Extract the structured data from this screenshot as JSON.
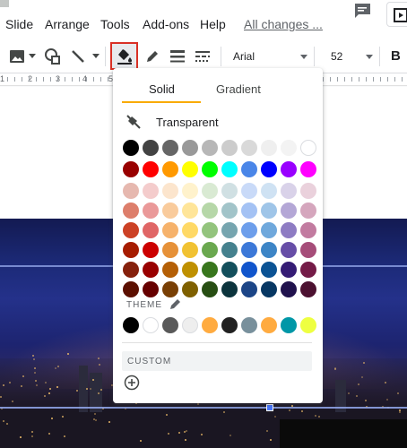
{
  "menu": {
    "items": [
      "Slide",
      "Arrange",
      "Tools",
      "Add-ons",
      "Help"
    ],
    "changes_link": "All changes ..."
  },
  "toolbar": {
    "icons": [
      "image-icon",
      "shapes-icon",
      "line-icon",
      "fill-color-icon",
      "pen-icon",
      "border-weight-icon",
      "border-dash-icon"
    ],
    "font": "Arial",
    "size": "52",
    "bold_label": "B",
    "active_tool": "fill-color"
  },
  "ruler": {
    "labels": [
      "1",
      "2",
      "3",
      "4",
      "5"
    ]
  },
  "color_panel": {
    "tabs": [
      {
        "label": "Solid",
        "selected": true
      },
      {
        "label": "Gradient",
        "selected": false
      }
    ],
    "transparent_label": "Transparent",
    "theme_label": "THEME",
    "custom_label": "CUSTOM",
    "grid_rows": [
      [
        "#000000",
        "#434343",
        "#666666",
        "#999999",
        "#b7b7b7",
        "#cccccc",
        "#d9d9d9",
        "#efefef",
        "#f3f3f3",
        "#ffffff"
      ],
      [
        "#980000",
        "#ff0000",
        "#ff9900",
        "#ffff00",
        "#00ff00",
        "#00ffff",
        "#4a86e8",
        "#0000ff",
        "#9900ff",
        "#ff00ff"
      ],
      [
        "#e6b8af",
        "#f4cccc",
        "#fce5cd",
        "#fff2cc",
        "#d9ead3",
        "#d0e0e3",
        "#c9daf8",
        "#cfe2f3",
        "#d9d2e9",
        "#ead1dc"
      ],
      [
        "#dd7e6b",
        "#ea9999",
        "#f9cb9c",
        "#ffe599",
        "#b6d7a8",
        "#a2c4c9",
        "#a4c2f4",
        "#9fc5e8",
        "#b4a7d6",
        "#d5a6bd"
      ],
      [
        "#cc4125",
        "#e06666",
        "#f6b26b",
        "#ffd966",
        "#93c47d",
        "#76a5af",
        "#6d9eeb",
        "#6fa8dc",
        "#8e7cc3",
        "#c27ba0"
      ],
      [
        "#a61c00",
        "#cc0000",
        "#e69138",
        "#f1c232",
        "#6aa84f",
        "#45818e",
        "#3c78d8",
        "#3d85c6",
        "#674ea7",
        "#a64d79"
      ],
      [
        "#85200c",
        "#990000",
        "#b45f06",
        "#bf9000",
        "#38761d",
        "#134f5c",
        "#1155cc",
        "#0b5394",
        "#351c75",
        "#741b47"
      ],
      [
        "#5b0f00",
        "#660000",
        "#783f04",
        "#7f6000",
        "#274e13",
        "#0c343d",
        "#1c4587",
        "#073763",
        "#20124d",
        "#4c1130"
      ]
    ],
    "theme_colors": [
      "#000000",
      "#ffffff",
      "#595959",
      "#eeeeee",
      "#ffab40",
      "#212121",
      "#78909c",
      "#ffab40",
      "#0097a7",
      "#eeff41"
    ],
    "colors": {
      "tab_underline": "#f9ab00",
      "active_border": "#d93025"
    }
  }
}
